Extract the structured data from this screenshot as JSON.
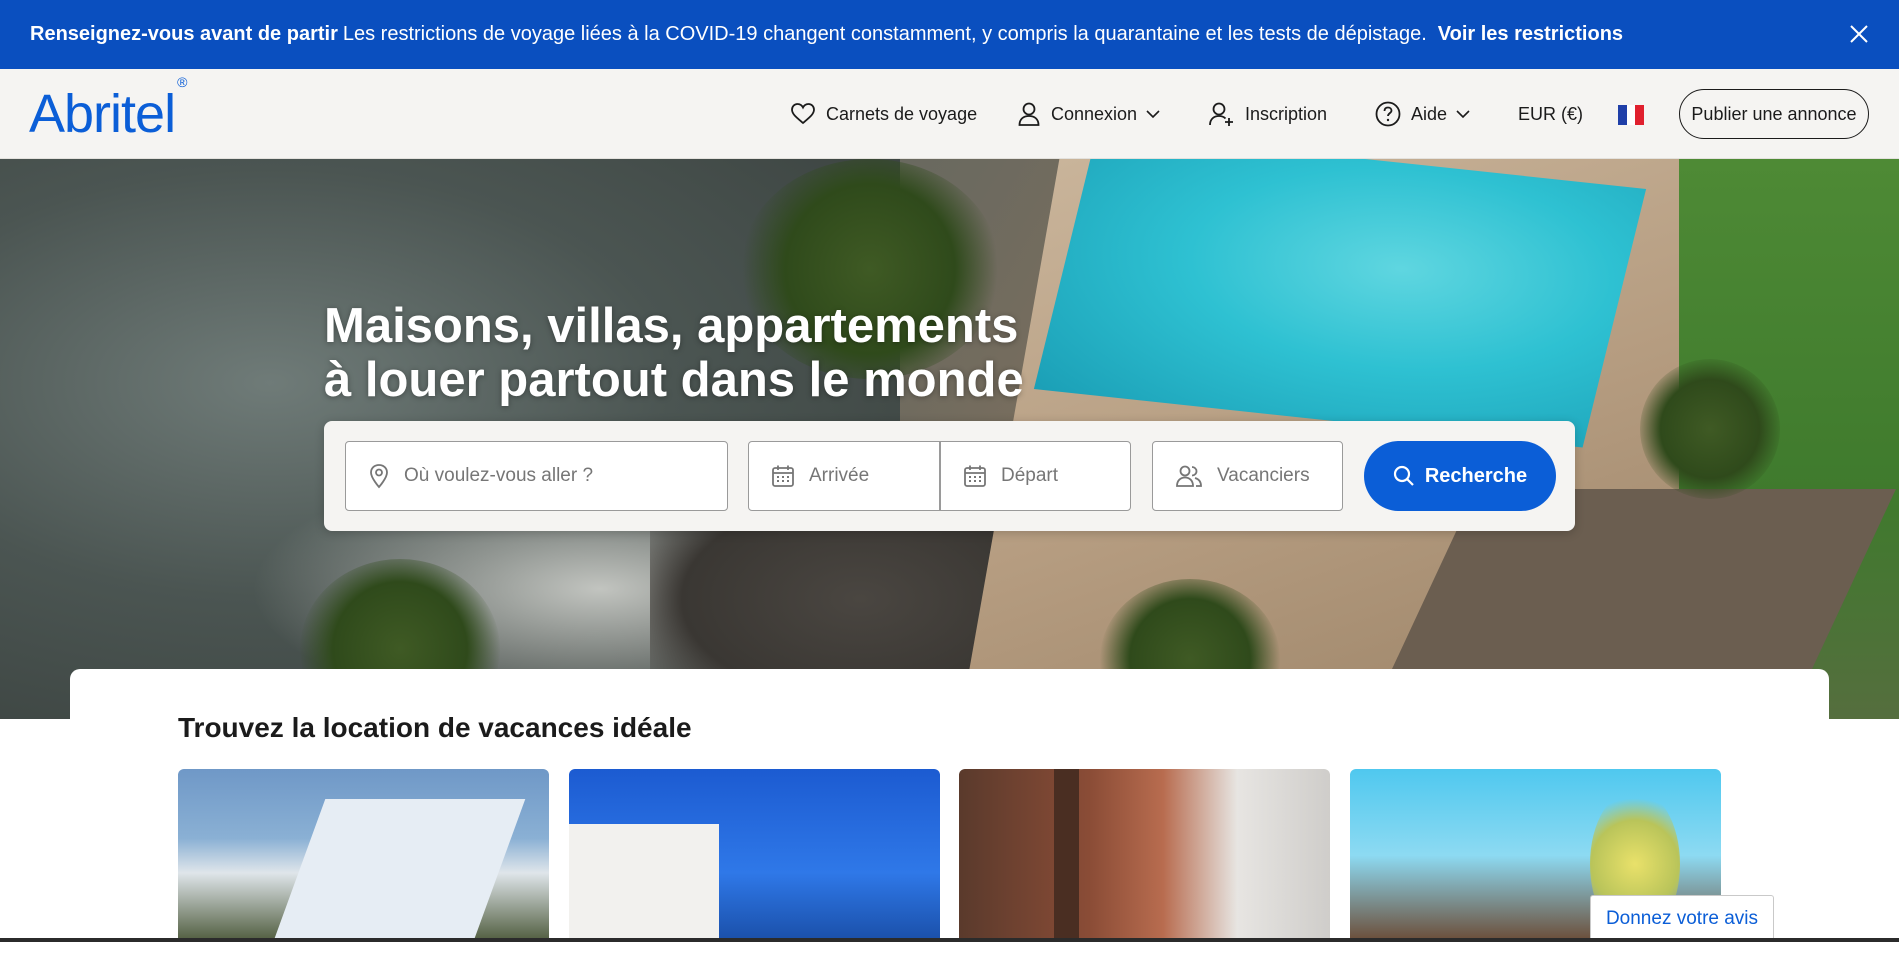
{
  "banner": {
    "bold_text": "Renseignez-vous avant de partir",
    "message": "Les restrictions de voyage liées à la COVID-19 changent constamment, y compris la quarantaine et les tests de dépistage.",
    "link": "Voir les restrictions",
    "background": "#0a4fbf"
  },
  "header": {
    "logo": "Abritel",
    "logo_mark": "®",
    "nav": {
      "trips": "Carnets de voyage",
      "login": "Connexion",
      "signup": "Inscription",
      "help": "Aide",
      "currency": "EUR (€)",
      "publish": "Publier une annonce"
    }
  },
  "hero": {
    "title_line1": "Maisons, villas, appartements",
    "title_line2": "à louer partout dans le monde"
  },
  "search": {
    "destination_placeholder": "Où voulez-vous aller ?",
    "arrival_placeholder": "Arrivée",
    "departure_placeholder": "Départ",
    "guests_placeholder": "Vacanciers",
    "button": "Recherche",
    "accent": "#0b5ed7"
  },
  "section": {
    "title": "Trouvez la location de vacances idéale"
  },
  "feedback": {
    "label": "Donnez votre avis"
  },
  "icons": [
    "close-icon",
    "heart-icon",
    "user-icon",
    "chevron-down-icon",
    "user-add-icon",
    "help-circle-icon",
    "flag-fr-icon",
    "map-pin-icon",
    "calendar-icon",
    "users-icon",
    "search-icon"
  ]
}
